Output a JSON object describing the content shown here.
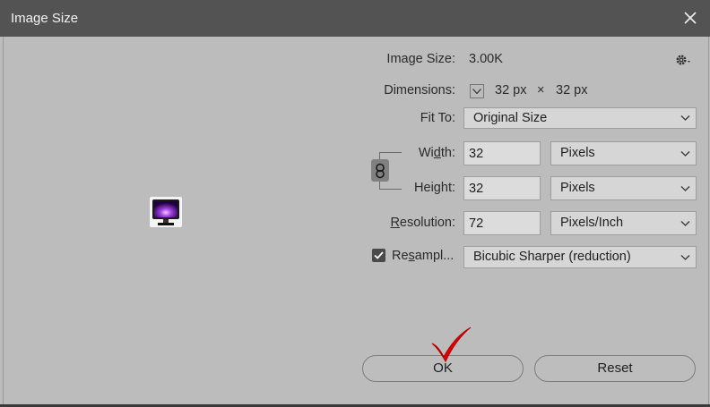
{
  "window": {
    "title": "Image Size"
  },
  "info": {
    "image_size_label": "Image Size:",
    "image_size_value": "3.00K",
    "dimensions_label": "Dimensions:",
    "dimensions_w": "32 px",
    "dimensions_x": "×",
    "dimensions_h": "32 px"
  },
  "fit_to": {
    "label": "Fit To:",
    "value": "Original Size"
  },
  "width": {
    "label_pre": "Wi",
    "label_u": "d",
    "label_post": "th:",
    "value": "32",
    "unit": "Pixels"
  },
  "height": {
    "label_pre": "Hei",
    "label_u": "g",
    "label_post": "ht:",
    "value": "32",
    "unit": "Pixels"
  },
  "resolution": {
    "label_pre": "",
    "label_u": "R",
    "label_post": "esolution:",
    "value": "72",
    "unit": "Pixels/Inch"
  },
  "resample": {
    "label_pre": "Re",
    "label_u": "s",
    "label_post": "ampl...",
    "checked": true,
    "value": "Bicubic Sharper (reduction)"
  },
  "buttons": {
    "ok": "OK",
    "reset": "Reset"
  },
  "colors": {
    "titlebar": "#535353",
    "body": "#bcbcbc",
    "checkmark_annotation": "#e00000"
  },
  "icons": [
    "close-icon",
    "gear-icon",
    "chevron-down-icon",
    "link-icon",
    "checkbox-check-icon",
    "checkmark-annotation-icon"
  ]
}
